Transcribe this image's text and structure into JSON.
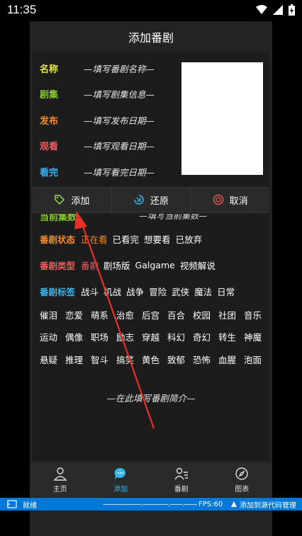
{
  "status_bar": {
    "time": "11:35"
  },
  "title": "添加番剧",
  "fields": [
    {
      "label": "名称",
      "placeholder": "—填写番剧名称—",
      "color": "#e8e83c"
    },
    {
      "label": "剧集",
      "placeholder": "—填写剧集信息—",
      "color": "#88cc22"
    },
    {
      "label": "发布",
      "placeholder": "—填写发布日期—",
      "color": "#f28c28"
    },
    {
      "label": "观看",
      "placeholder": "—填写观看日期—",
      "color": "#ee5b5b"
    },
    {
      "label": "看完",
      "placeholder": "—填写看完日期—",
      "color": "#35b6ef"
    }
  ],
  "actions": {
    "add": "添加",
    "reset": "还原",
    "cancel": "取消"
  },
  "partial_row": {
    "label": "当前集数",
    "placeholder": "—填写当前集数—"
  },
  "status": {
    "label": "番剧状态",
    "options": [
      "正在看",
      "已看完",
      "想要看",
      "已放弃"
    ],
    "label_color": "#f28c28"
  },
  "type": {
    "label": "番剧类型",
    "options": [
      "番剧",
      "剧场版",
      "Galgame",
      "视频解说"
    ],
    "label_color": "#ee5b5b"
  },
  "tags": {
    "label": "番剧标签",
    "label_color": "#35b6ef",
    "row1": [
      "战斗",
      "机战",
      "战争",
      "冒险",
      "武侠",
      "魔法",
      "日常"
    ],
    "row2": [
      "催泪",
      "恋爱",
      "萌系",
      "治愈",
      "后宫",
      "百合",
      "校园",
      "社团",
      "音乐"
    ],
    "row3": [
      "运动",
      "偶像",
      "职场",
      "励志",
      "穿越",
      "科幻",
      "奇幻",
      "转生",
      "神魔"
    ],
    "row4": [
      "悬疑",
      "推理",
      "智斗",
      "搞笑",
      "黄色",
      "致郁",
      "恐怖",
      "血腥",
      "泡面"
    ]
  },
  "intro_placeholder": "—在此填写番剧简介—",
  "nav": [
    "主页",
    "添加",
    "番剧",
    "图表"
  ],
  "ide_bar": {
    "ready": "就绪",
    "dashes": "——————.————.——.——",
    "fps": "FPS:60",
    "source": "添加到源代码管理"
  },
  "colors": {
    "accent": "#35b6ef",
    "arrow": "#e8302a",
    "ide_blue": "#0078d7"
  }
}
